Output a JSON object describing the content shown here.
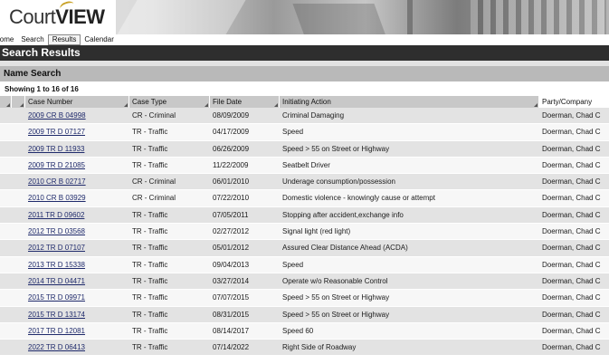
{
  "app": {
    "logo_text_a": "Court",
    "logo_text_b": "VIEW"
  },
  "nav": {
    "items": [
      {
        "label": "Home"
      },
      {
        "label": "Search"
      },
      {
        "label": "Results"
      },
      {
        "label": "Calendar"
      }
    ]
  },
  "page": {
    "results_title": "Search Results",
    "section_title": "Name Search",
    "showing_text": "Showing 1 to 16 of 16"
  },
  "table": {
    "headers": {
      "case_number": "Case Number",
      "case_type": "Case Type",
      "file_date": "File Date",
      "initiating_action": "Initiating Action",
      "party": "Party/Company"
    },
    "rows": [
      {
        "case_number": "2009 CR B 04998",
        "case_type": "CR - Criminal",
        "file_date": "08/09/2009",
        "action": "Criminal Damaging",
        "party": "Doerman, Chad C"
      },
      {
        "case_number": "2009 TR D 07127",
        "case_type": "TR - Traffic",
        "file_date": "04/17/2009",
        "action": "Speed",
        "party": "Doerman, Chad C"
      },
      {
        "case_number": "2009 TR D 11933",
        "case_type": "TR - Traffic",
        "file_date": "06/26/2009",
        "action": "Speed > 55 on Street or Highway",
        "party": "Doerman, Chad C"
      },
      {
        "case_number": "2009 TR D 21085",
        "case_type": "TR - Traffic",
        "file_date": "11/22/2009",
        "action": "Seatbelt Driver",
        "party": "Doerman, Chad C"
      },
      {
        "case_number": "2010 CR B 02717",
        "case_type": "CR - Criminal",
        "file_date": "06/01/2010",
        "action": "Underage consumption/possession",
        "party": "Doerman, Chad C"
      },
      {
        "case_number": "2010 CR B 03929",
        "case_type": "CR - Criminal",
        "file_date": "07/22/2010",
        "action": "Domestic violence - knowingly cause or attempt",
        "party": "Doerman, Chad C"
      },
      {
        "case_number": "2011 TR D 09602",
        "case_type": "TR - Traffic",
        "file_date": "07/05/2011",
        "action": "Stopping after accident,exchange info",
        "party": "Doerman, Chad C"
      },
      {
        "case_number": "2012 TR D 03568",
        "case_type": "TR - Traffic",
        "file_date": "02/27/2012",
        "action": "Signal light (red light)",
        "party": "Doerman, Chad C"
      },
      {
        "case_number": "2012 TR D 07107",
        "case_type": "TR - Traffic",
        "file_date": "05/01/2012",
        "action": "Assured Clear Distance Ahead (ACDA)",
        "party": "Doerman, Chad C"
      },
      {
        "case_number": "2013 TR D 15338",
        "case_type": "TR - Traffic",
        "file_date": "09/04/2013",
        "action": "Speed",
        "party": "Doerman, Chad C"
      },
      {
        "case_number": "2014 TR D 04471",
        "case_type": "TR - Traffic",
        "file_date": "03/27/2014",
        "action": "Operate w/o Reasonable Control",
        "party": "Doerman, Chad C"
      },
      {
        "case_number": "2015 TR D 09971",
        "case_type": "TR - Traffic",
        "file_date": "07/07/2015",
        "action": "Speed > 55 on Street or Highway",
        "party": "Doerman, Chad C"
      },
      {
        "case_number": "2015 TR D 13174",
        "case_type": "TR - Traffic",
        "file_date": "08/31/2015",
        "action": "Speed > 55 on Street or Highway",
        "party": "Doerman, Chad C"
      },
      {
        "case_number": "2017 TR D 12081",
        "case_type": "TR - Traffic",
        "file_date": "08/14/2017",
        "action": "Speed 60",
        "party": "Doerman, Chad C"
      },
      {
        "case_number": "2022 TR D 06413",
        "case_type": "TR - Traffic",
        "file_date": "07/14/2022",
        "action": "Right Side of Roadway",
        "party": "Doerman, Chad C"
      }
    ]
  }
}
